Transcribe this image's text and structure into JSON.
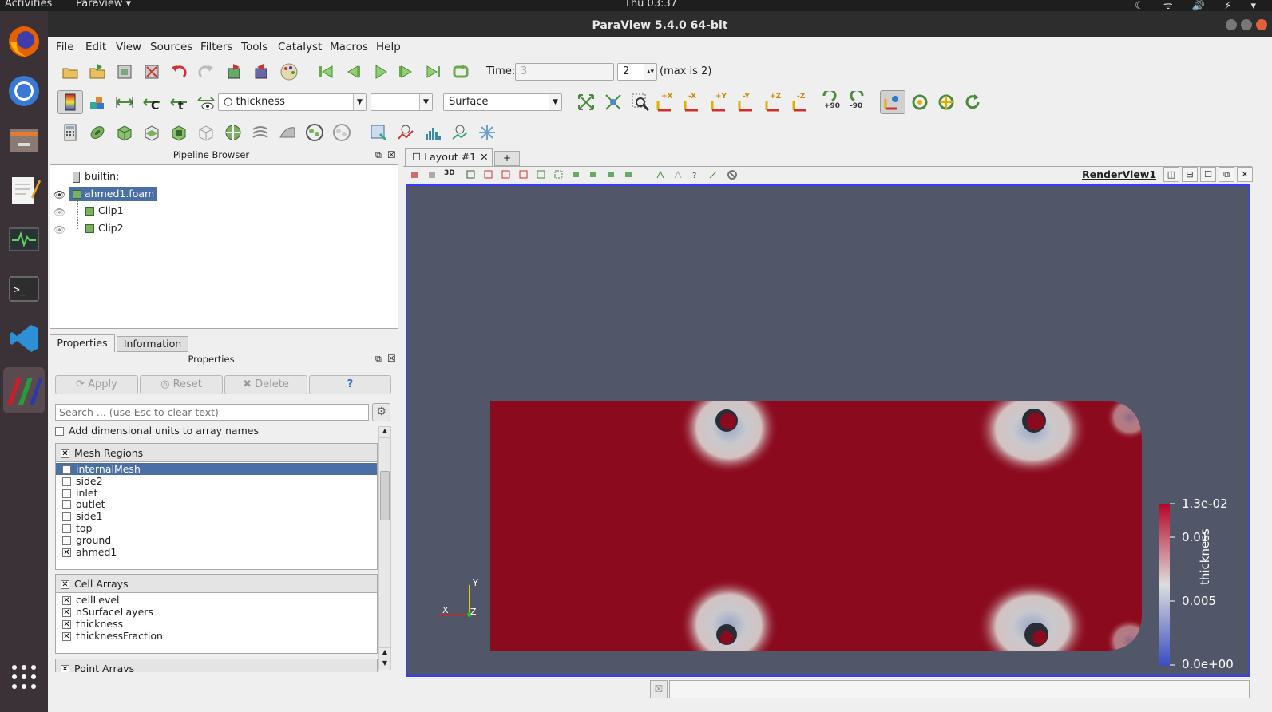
{
  "topbar": {
    "activities": "Activities",
    "app": "Paraview ▾",
    "clock": "Thu 03:37",
    "tray": "☾ ᯤ 🔊 ⚡ ▾"
  },
  "window": {
    "title": "ParaView 5.4.0 64-bit"
  },
  "menu": [
    "File",
    "Edit",
    "View",
    "Sources",
    "Filters",
    "Tools",
    "Catalyst",
    "Macros",
    "Help"
  ],
  "time": {
    "label": "Time:",
    "value": "3",
    "index": "2",
    "max": "(max is 2)"
  },
  "toolbar2": {
    "array": "thickness",
    "component": "",
    "representation": "Surface",
    "view_labels": [
      "+X",
      "-X",
      "+Y",
      "-Y",
      "+Z",
      "-Z",
      "+90",
      "-90"
    ]
  },
  "pipeline": {
    "title": "Pipeline Browser",
    "items": [
      {
        "label": "builtin:"
      },
      {
        "label": "ahmed1.foam"
      },
      {
        "label": "Clip1"
      },
      {
        "label": "Clip2"
      }
    ]
  },
  "tabs": {
    "properties": "Properties",
    "information": "Information"
  },
  "properties": {
    "title": "Properties",
    "apply": "Apply",
    "reset": "Reset",
    "delete": "Delete",
    "help": "?",
    "search_placeholder": "Search ... (use Esc to clear text)",
    "dim_units": "Add dimensional units to array names",
    "mesh_regions": {
      "header": "Mesh Regions",
      "items": [
        {
          "label": "internalMesh",
          "checked": false
        },
        {
          "label": "side2",
          "checked": false
        },
        {
          "label": "inlet",
          "checked": false
        },
        {
          "label": "outlet",
          "checked": false
        },
        {
          "label": "side1",
          "checked": false
        },
        {
          "label": "top",
          "checked": false
        },
        {
          "label": "ground",
          "checked": false
        },
        {
          "label": "ahmed1",
          "checked": true
        }
      ]
    },
    "cell_arrays": {
      "header": "Cell Arrays",
      "items": [
        {
          "label": "cellLevel",
          "checked": true
        },
        {
          "label": "nSurfaceLayers",
          "checked": true
        },
        {
          "label": "thickness",
          "checked": true
        },
        {
          "label": "thicknessFraction",
          "checked": true
        }
      ]
    },
    "point_arrays": {
      "header": "Point Arrays"
    }
  },
  "layout": {
    "tab": "Layout #1",
    "add": "+",
    "three_d": "3D",
    "view_name": "RenderView1"
  },
  "colorbar": {
    "title": "thickness",
    "max": "1.3e-02",
    "mid1": "0.01",
    "mid2": "0.005",
    "min": "0.0e+00"
  },
  "axes": {
    "x": "X",
    "y": "Y",
    "z": "Z"
  },
  "colors": {
    "accent": "#4a6fa5",
    "surface": "#8b0a1e",
    "background": "#525669"
  }
}
